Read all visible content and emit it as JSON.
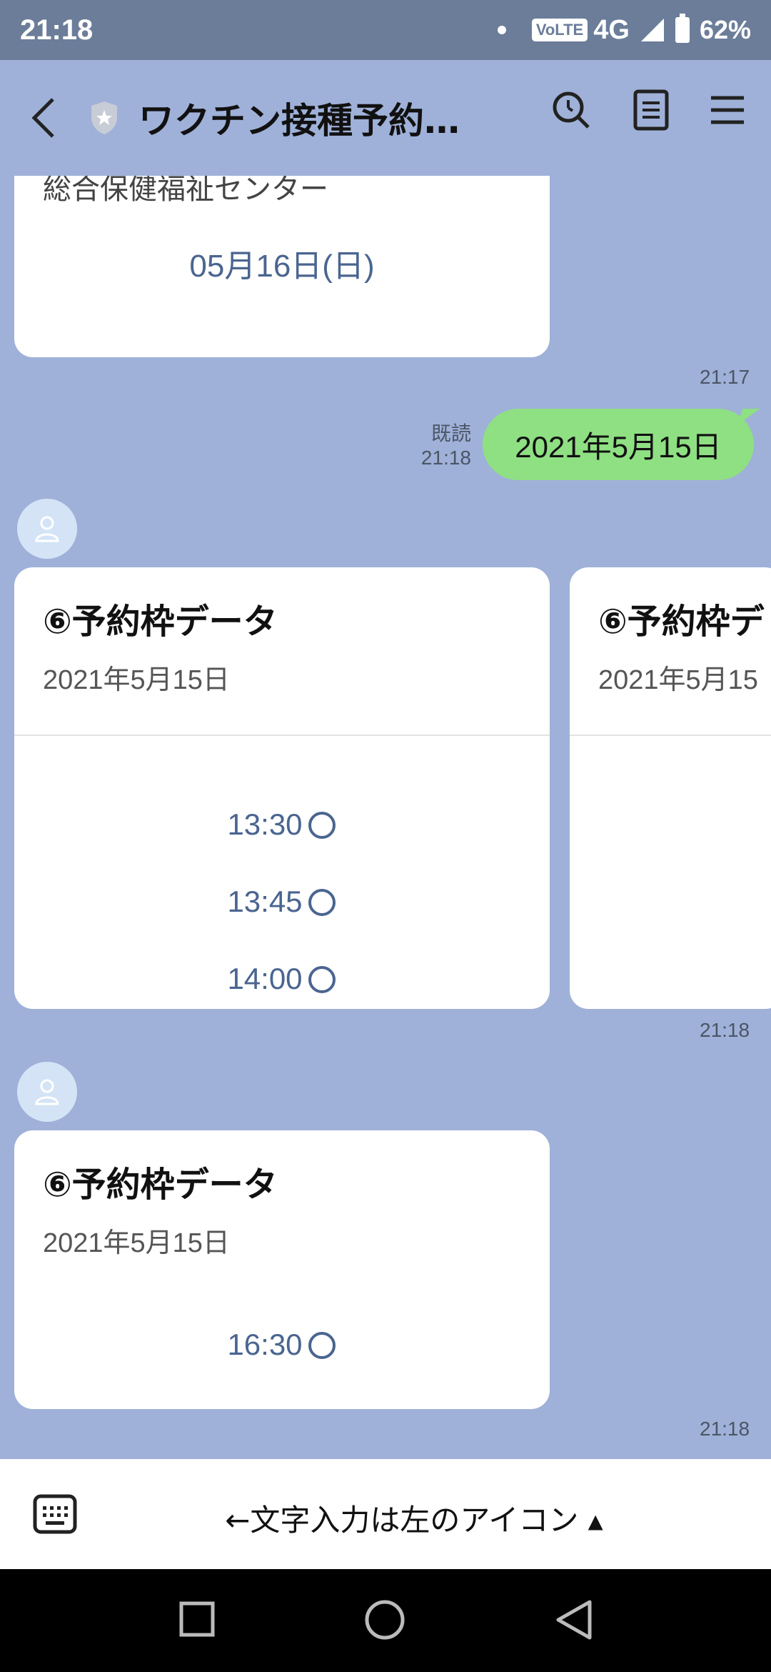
{
  "status": {
    "time": "21:18",
    "network": "4G",
    "volte": "VoLTE",
    "battery": "62%"
  },
  "header": {
    "title": "ワクチン接種予約..."
  },
  "messages": {
    "prev_card": {
      "location": "総合保健福祉センター",
      "date_button": "05月16日(日)",
      "time": "21:17"
    },
    "user_message": {
      "text": "2021年5月15日",
      "read_label": "既読",
      "time": "21:18"
    },
    "carousel1": {
      "card1": {
        "title": "⑥予約枠データ",
        "date": "2021年5月15日",
        "slots": [
          "13:30",
          "13:45",
          "14:00"
        ]
      },
      "card2": {
        "title": "⑥予約枠デ",
        "date": "2021年5月15"
      },
      "time": "21:18"
    },
    "carousel2": {
      "card1": {
        "title": "⑥予約枠データ",
        "date": "2021年5月15日",
        "slots": [
          "16:30"
        ]
      },
      "time": "21:18"
    }
  },
  "input": {
    "hint": "←文字入力は左のアイコン ▴"
  },
  "colors": {
    "chat_bg": "#9fb1d8",
    "bubble": "#8fdf83",
    "link": "#4a6590"
  }
}
